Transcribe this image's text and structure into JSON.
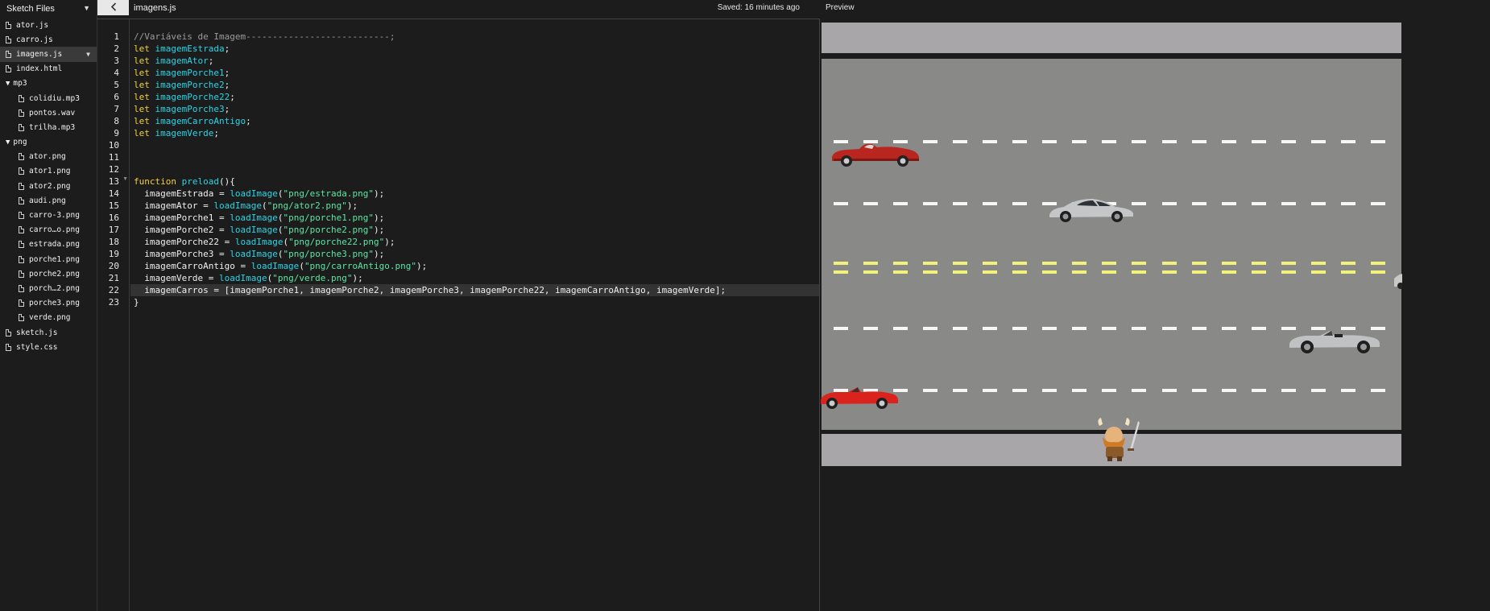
{
  "sidebar": {
    "title": "Sketch Files",
    "files": [
      {
        "name": "ator.js",
        "type": "file",
        "level": 0
      },
      {
        "name": "carro.js",
        "type": "file",
        "level": 0
      },
      {
        "name": "imagens.js",
        "type": "file",
        "level": 0,
        "active": true
      },
      {
        "name": "index.html",
        "type": "file",
        "level": 0
      },
      {
        "name": "mp3",
        "type": "folder",
        "level": 0
      },
      {
        "name": "colidiu.mp3",
        "type": "file",
        "level": 1
      },
      {
        "name": "pontos.wav",
        "type": "file",
        "level": 1
      },
      {
        "name": "trilha.mp3",
        "type": "file",
        "level": 1
      },
      {
        "name": "png",
        "type": "folder",
        "level": 0
      },
      {
        "name": "ator.png",
        "type": "file",
        "level": 1
      },
      {
        "name": "ator1.png",
        "type": "file",
        "level": 1
      },
      {
        "name": "ator2.png",
        "type": "file",
        "level": 1
      },
      {
        "name": "audi.png",
        "type": "file",
        "level": 1
      },
      {
        "name": "carro-3.png",
        "type": "file",
        "level": 1
      },
      {
        "name": "carro…o.png",
        "type": "file",
        "level": 1
      },
      {
        "name": "estrada.png",
        "type": "file",
        "level": 1
      },
      {
        "name": "porche1.png",
        "type": "file",
        "level": 1
      },
      {
        "name": "porche2.png",
        "type": "file",
        "level": 1
      },
      {
        "name": "porch…2.png",
        "type": "file",
        "level": 1
      },
      {
        "name": "porche3.png",
        "type": "file",
        "level": 1
      },
      {
        "name": "verde.png",
        "type": "file",
        "level": 1
      },
      {
        "name": "sketch.js",
        "type": "file",
        "level": 0
      },
      {
        "name": "style.css",
        "type": "file",
        "level": 0
      }
    ]
  },
  "toolbar": {
    "back_icon": "chevron-left-icon",
    "filename": "imagens.js",
    "saved_status": "Saved: 16 minutes ago",
    "preview_label": "Preview"
  },
  "editor": {
    "highlighted_line": 22,
    "lines": [
      {
        "num": "1",
        "tokens": [
          {
            "t": "com",
            "s": "//Variáveis de Imagem---------------------------;"
          }
        ]
      },
      {
        "num": "2",
        "tokens": [
          {
            "t": "kw",
            "s": "let "
          },
          {
            "t": "var",
            "s": "imagemEstrada"
          },
          {
            "t": "plain",
            "s": ";"
          }
        ]
      },
      {
        "num": "3",
        "tokens": [
          {
            "t": "kw",
            "s": "let "
          },
          {
            "t": "var",
            "s": "imagemAtor"
          },
          {
            "t": "plain",
            "s": ";"
          }
        ]
      },
      {
        "num": "4",
        "tokens": [
          {
            "t": "kw",
            "s": "let "
          },
          {
            "t": "var",
            "s": "imagemPorche1"
          },
          {
            "t": "plain",
            "s": ";"
          }
        ]
      },
      {
        "num": "5",
        "tokens": [
          {
            "t": "kw",
            "s": "let "
          },
          {
            "t": "var",
            "s": "imagemPorche2"
          },
          {
            "t": "plain",
            "s": ";"
          }
        ]
      },
      {
        "num": "6",
        "tokens": [
          {
            "t": "kw",
            "s": "let "
          },
          {
            "t": "var",
            "s": "imagemPorche22"
          },
          {
            "t": "plain",
            "s": ";"
          }
        ]
      },
      {
        "num": "7",
        "tokens": [
          {
            "t": "kw",
            "s": "let "
          },
          {
            "t": "var",
            "s": "imagemPorche3"
          },
          {
            "t": "plain",
            "s": ";"
          }
        ]
      },
      {
        "num": "8",
        "tokens": [
          {
            "t": "kw",
            "s": "let "
          },
          {
            "t": "var",
            "s": "imagemCarroAntigo"
          },
          {
            "t": "plain",
            "s": ";"
          }
        ]
      },
      {
        "num": "9",
        "tokens": [
          {
            "t": "kw",
            "s": "let "
          },
          {
            "t": "var",
            "s": "imagemVerde"
          },
          {
            "t": "plain",
            "s": ";"
          }
        ]
      },
      {
        "num": "10",
        "tokens": []
      },
      {
        "num": "11",
        "tokens": []
      },
      {
        "num": "12",
        "tokens": []
      },
      {
        "num": "13",
        "fold": true,
        "tokens": [
          {
            "t": "kw",
            "s": "function "
          },
          {
            "t": "fn",
            "s": "preload"
          },
          {
            "t": "plain",
            "s": "(){"
          }
        ]
      },
      {
        "num": "14",
        "tokens": [
          {
            "t": "plain",
            "s": "  imagemEstrada = "
          },
          {
            "t": "fn",
            "s": "loadImage"
          },
          {
            "t": "plain",
            "s": "("
          },
          {
            "t": "str",
            "s": "\"png/estrada.png\""
          },
          {
            "t": "plain",
            "s": ");"
          }
        ]
      },
      {
        "num": "15",
        "tokens": [
          {
            "t": "plain",
            "s": "  imagemAtor = "
          },
          {
            "t": "fn",
            "s": "loadImage"
          },
          {
            "t": "plain",
            "s": "("
          },
          {
            "t": "str",
            "s": "\"png/ator2.png\""
          },
          {
            "t": "plain",
            "s": ");"
          }
        ]
      },
      {
        "num": "16",
        "tokens": [
          {
            "t": "plain",
            "s": "  imagemPorche1 = "
          },
          {
            "t": "fn",
            "s": "loadImage"
          },
          {
            "t": "plain",
            "s": "("
          },
          {
            "t": "str",
            "s": "\"png/porche1.png\""
          },
          {
            "t": "plain",
            "s": ");"
          }
        ]
      },
      {
        "num": "17",
        "tokens": [
          {
            "t": "plain",
            "s": "  imagemPorche2 = "
          },
          {
            "t": "fn",
            "s": "loadImage"
          },
          {
            "t": "plain",
            "s": "("
          },
          {
            "t": "str",
            "s": "\"png/porche2.png\""
          },
          {
            "t": "plain",
            "s": ");"
          }
        ]
      },
      {
        "num": "18",
        "tokens": [
          {
            "t": "plain",
            "s": "  imagemPorche22 = "
          },
          {
            "t": "fn",
            "s": "loadImage"
          },
          {
            "t": "plain",
            "s": "("
          },
          {
            "t": "str",
            "s": "\"png/porche22.png\""
          },
          {
            "t": "plain",
            "s": ");"
          }
        ]
      },
      {
        "num": "19",
        "tokens": [
          {
            "t": "plain",
            "s": "  imagemPorche3 = "
          },
          {
            "t": "fn",
            "s": "loadImage"
          },
          {
            "t": "plain",
            "s": "("
          },
          {
            "t": "str",
            "s": "\"png/porche3.png\""
          },
          {
            "t": "plain",
            "s": ");"
          }
        ]
      },
      {
        "num": "20",
        "tokens": [
          {
            "t": "plain",
            "s": "  imagemCarroAntigo = "
          },
          {
            "t": "fn",
            "s": "loadImage"
          },
          {
            "t": "plain",
            "s": "("
          },
          {
            "t": "str",
            "s": "\"png/carroAntigo.png\""
          },
          {
            "t": "plain",
            "s": ");"
          }
        ]
      },
      {
        "num": "21",
        "tokens": [
          {
            "t": "plain",
            "s": "  imagemVerde = "
          },
          {
            "t": "fn",
            "s": "loadImage"
          },
          {
            "t": "plain",
            "s": "("
          },
          {
            "t": "str",
            "s": "\"png/verde.png\""
          },
          {
            "t": "plain",
            "s": ");"
          }
        ]
      },
      {
        "num": "22",
        "tokens": [
          {
            "t": "plain",
            "s": "  imagemCarros = [imagemPorche1, imagemPorche2, imagemPorche3, imagemPorche22, imagemCarroAntigo, imagemVerde];"
          }
        ]
      },
      {
        "num": "23",
        "tokens": [
          {
            "t": "plain",
            "s": "}"
          }
        ]
      }
    ]
  },
  "preview": {
    "colors": {
      "road": "#898988",
      "sidewalk": "#a8a6a9",
      "lane_white": "#f7f7f7",
      "lane_yellow": "#f2f27a"
    },
    "sprites": [
      "vintage-red-car",
      "silver-porsche",
      "silver-convertible",
      "red-convertible",
      "partial-car",
      "viking-player"
    ]
  }
}
